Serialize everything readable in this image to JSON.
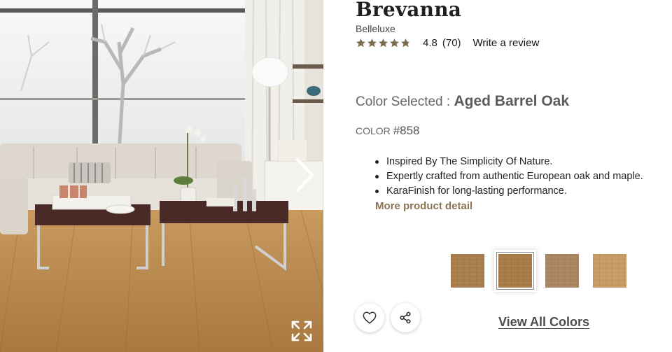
{
  "product": {
    "title": "Brevanna",
    "brand": "Belleluxe",
    "rating": 4.8,
    "rating_label": "4.8",
    "review_count_label": "(70)",
    "write_review_label": "Write a review"
  },
  "color": {
    "selected_label": "Color Selected :",
    "selected_value": "Aged Barrel Oak",
    "code_label": "COLOR",
    "code_value": "#858"
  },
  "features": [
    "Inspired By The Simplicity Of Nature.",
    "Expertly crafted from authentic European oak and maple.",
    "KaraFinish for long-lasting performance."
  ],
  "more_detail_label": "More product detail",
  "swatches": [
    {
      "name": "swatch-1",
      "color": "#a87d4c",
      "selected": false
    },
    {
      "name": "swatch-2",
      "color": "#a67a45",
      "selected": true
    },
    {
      "name": "swatch-3",
      "color": "#a88560",
      "selected": false
    },
    {
      "name": "swatch-4",
      "color": "#c69b62",
      "selected": false
    }
  ],
  "actions": {
    "favorite_icon": "heart-icon",
    "share_icon": "share-icon",
    "view_all_label": "View All Colors"
  },
  "gallery": {
    "next_icon": "chevron-right-icon",
    "expand_icon": "expand-icon"
  },
  "colors": {
    "accent_brown": "#8a7453",
    "star": "#7a6a4f"
  }
}
